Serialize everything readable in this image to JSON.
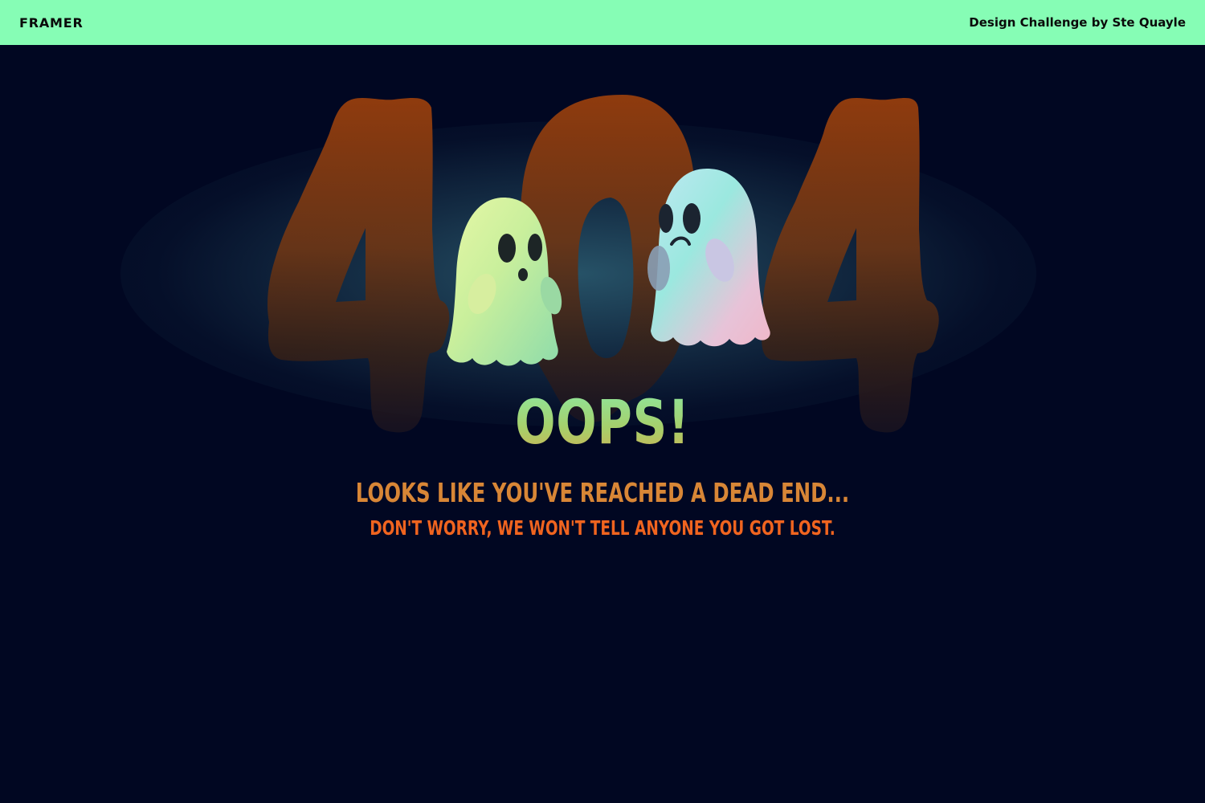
{
  "header": {
    "brand": "FRAMER",
    "credit": "Design Challenge by Ste Quayle"
  },
  "hero": {
    "code_digits": [
      "4",
      "0",
      "4"
    ],
    "title": "OOPS!",
    "line1": "LOOKS LIKE YOU'VE REACHED A DEAD END...",
    "line2": "DON'T WORRY, WE WON'T TELL ANYONE YOU GOT LOST."
  },
  "icons": {
    "ghost_left": "ghost-surprised-icon",
    "ghost_right": "ghost-sad-icon"
  },
  "colors": {
    "background": "#010722",
    "topbar": "#86fdb5",
    "digits": "#8a3a10",
    "title": "#a7cf6a",
    "line1": "#d88636",
    "line2": "#f0641f"
  }
}
